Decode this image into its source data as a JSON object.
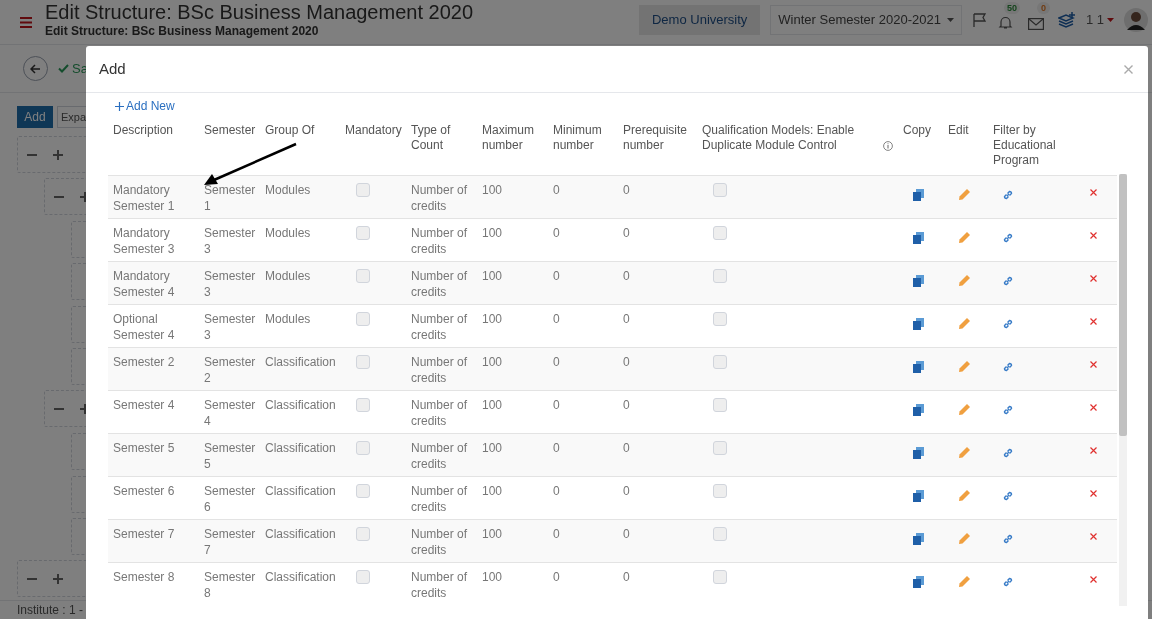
{
  "header": {
    "title": "Edit Structure: BSc Business Management 2020",
    "subtitle": "Edit Structure: BSc Business Management 2020",
    "institution": "Demo University",
    "term": "Winter Semester 2020-2021",
    "notifications": "50",
    "messages": "0",
    "user": "1 1"
  },
  "toolbar": {
    "save": "Sa",
    "add": "Add",
    "expand": "Expa"
  },
  "footer": "Institute : 1 -",
  "modal": {
    "title": "Add",
    "add_new": "Add New",
    "columns": [
      {
        "label": "Description"
      },
      {
        "label": "Semester"
      },
      {
        "label": "Group Of"
      },
      {
        "label": "Mandatory"
      },
      {
        "label": "Type of Count"
      },
      {
        "label": "Maximum number"
      },
      {
        "label": "Minimum number"
      },
      {
        "label": "Prerequisite number"
      },
      {
        "label": "Qualification Models: Enable Duplicate Module Control",
        "hint": true
      },
      {
        "label": "Copy"
      },
      {
        "label": "Edit"
      },
      {
        "label": "Filter by Educational Program"
      }
    ],
    "rows": [
      {
        "description": "Mandatory Semester 1",
        "semester": "Semester 1",
        "group_of": "Modules",
        "mandatory": false,
        "type_of_count": "Number of credits",
        "maximum": "100",
        "minimum": "0",
        "prerequisite": "0",
        "duplicate_control": false
      },
      {
        "description": "Mandatory Semester 3",
        "semester": "Semester 3",
        "group_of": "Modules",
        "mandatory": false,
        "type_of_count": "Number of credits",
        "maximum": "100",
        "minimum": "0",
        "prerequisite": "0",
        "duplicate_control": false
      },
      {
        "description": "Mandatory Semester 4",
        "semester": "Semester 3",
        "group_of": "Modules",
        "mandatory": false,
        "type_of_count": "Number of credits",
        "maximum": "100",
        "minimum": "0",
        "prerequisite": "0",
        "duplicate_control": false
      },
      {
        "description": "Optional Semester 4",
        "semester": "Semester 3",
        "group_of": "Modules",
        "mandatory": false,
        "type_of_count": "Number of credits",
        "maximum": "100",
        "minimum": "0",
        "prerequisite": "0",
        "duplicate_control": false
      },
      {
        "description": "Semester 2",
        "semester": "Semester 2",
        "group_of": "Classification",
        "mandatory": false,
        "type_of_count": "Number of credits",
        "maximum": "100",
        "minimum": "0",
        "prerequisite": "0",
        "duplicate_control": false
      },
      {
        "description": "Semester 4",
        "semester": "Semester 4",
        "group_of": "Classification",
        "mandatory": false,
        "type_of_count": "Number of credits",
        "maximum": "100",
        "minimum": "0",
        "prerequisite": "0",
        "duplicate_control": false
      },
      {
        "description": "Semester 5",
        "semester": "Semester 5",
        "group_of": "Classification",
        "mandatory": false,
        "type_of_count": "Number of credits",
        "maximum": "100",
        "minimum": "0",
        "prerequisite": "0",
        "duplicate_control": false
      },
      {
        "description": "Semester 6",
        "semester": "Semester 6",
        "group_of": "Classification",
        "mandatory": false,
        "type_of_count": "Number of credits",
        "maximum": "100",
        "minimum": "0",
        "prerequisite": "0",
        "duplicate_control": false
      },
      {
        "description": "Semester 7",
        "semester": "Semester 7",
        "group_of": "Classification",
        "mandatory": false,
        "type_of_count": "Number of credits",
        "maximum": "100",
        "minimum": "0",
        "prerequisite": "0",
        "duplicate_control": false
      },
      {
        "description": "Semester 8",
        "semester": "Semester 8",
        "group_of": "Classification",
        "mandatory": false,
        "type_of_count": "Number of credits",
        "maximum": "100",
        "minimum": "0",
        "prerequisite": "0",
        "duplicate_control": false
      }
    ]
  }
}
